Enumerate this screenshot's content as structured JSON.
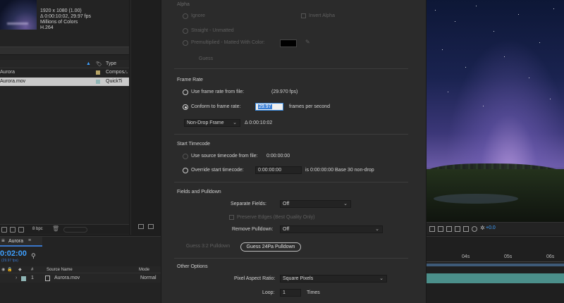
{
  "project": {
    "meta_line1": "1920 x 1080 (1.00)",
    "meta_line2": "Δ 0:00:10:02, 29.97 fps",
    "meta_line3": "Millions of Colors",
    "meta_line4": "H.264",
    "col_type": "Type",
    "items": [
      {
        "name": "Aurora",
        "type": "Compos",
        "swatch": "#b7a466"
      },
      {
        "name": "Aurora.mov",
        "type": "QuickTi",
        "swatch": "#8fb5b5"
      }
    ],
    "footer_bpc": "8 bpc"
  },
  "dialog": {
    "alpha_title": "Alpha",
    "alpha_ignore": "Ignore",
    "alpha_invert": "Invert Alpha",
    "alpha_straight": "Straight - Unmatted",
    "alpha_premult": "Premultiplied - Matted With Color:",
    "alpha_guess": "Guess",
    "framerate_title": "Frame Rate",
    "use_file_rate": "Use frame rate from file:",
    "file_rate_value": "(29.970 fps)",
    "conform_rate": "Conform to frame rate:",
    "conform_value": "29.97",
    "fps_unit": "frames per second",
    "dropframe_select": "Non-Drop Frame",
    "duration": "Δ 0:00:10:02",
    "timecode_title": "Start Timecode",
    "use_source_tc": "Use source timecode from file:",
    "source_tc_value": "0:00:00:00",
    "override_tc": "Override start timecode:",
    "override_tc_value": "0:00:00:00",
    "override_tc_info": "is 0:00:00:00  Base 30  non-drop",
    "fields_title": "Fields and Pulldown",
    "separate_fields_label": "Separate Fields:",
    "separate_fields_value": "Off",
    "preserve_edges": "Preserve Edges (Best Quality Only)",
    "remove_pulldown_label": "Remove Pulldown:",
    "remove_pulldown_value": "Off",
    "guess_32": "Guess 3:2 Pulldown",
    "guess_24pa": "Guess 24Pa Pulldown",
    "other_title": "Other Options",
    "par_label": "Pixel Aspect Ratio:",
    "par_value": "Square Pixels",
    "loop_label": "Loop:",
    "loop_value": "1",
    "loop_unit": "Times"
  },
  "timeline": {
    "tab_label": "Aurora",
    "timecode": "0:02:00",
    "fps_small": "(29.97 fps)",
    "col_hash": "#",
    "col_source": "Source Name",
    "col_mode": "Mode",
    "layer_index": "1",
    "layer_name": "Aurora.mov",
    "layer_mode": "Normal",
    "ruler": [
      "04s",
      "05s",
      "06s"
    ]
  },
  "viewer": {
    "exposure": "+0.0"
  },
  "colors": {
    "accent": "#3ea0ff",
    "selection": "#3a7fd6",
    "track": "#4b8f8a"
  }
}
